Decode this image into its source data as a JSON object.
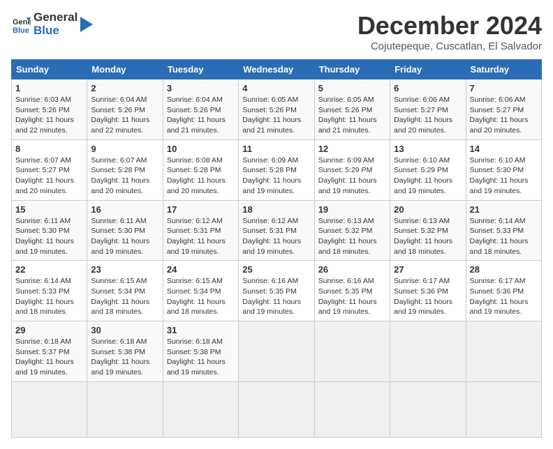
{
  "header": {
    "logo_general": "General",
    "logo_blue": "Blue",
    "title": "December 2024",
    "subtitle": "Cojutepeque, Cuscatlan, El Salvador"
  },
  "calendar": {
    "days_of_week": [
      "Sunday",
      "Monday",
      "Tuesday",
      "Wednesday",
      "Thursday",
      "Friday",
      "Saturday"
    ],
    "weeks": [
      [
        null,
        null,
        null,
        null,
        null,
        null,
        null
      ]
    ],
    "cells": [
      {
        "day": 1,
        "col": 0,
        "sunrise": "6:03 AM",
        "sunset": "5:26 PM",
        "daylight": "11 hours and 22 minutes."
      },
      {
        "day": 2,
        "col": 1,
        "sunrise": "6:04 AM",
        "sunset": "5:26 PM",
        "daylight": "11 hours and 22 minutes."
      },
      {
        "day": 3,
        "col": 2,
        "sunrise": "6:04 AM",
        "sunset": "5:26 PM",
        "daylight": "11 hours and 21 minutes."
      },
      {
        "day": 4,
        "col": 3,
        "sunrise": "6:05 AM",
        "sunset": "5:26 PM",
        "daylight": "11 hours and 21 minutes."
      },
      {
        "day": 5,
        "col": 4,
        "sunrise": "6:05 AM",
        "sunset": "5:26 PM",
        "daylight": "11 hours and 21 minutes."
      },
      {
        "day": 6,
        "col": 5,
        "sunrise": "6:06 AM",
        "sunset": "5:27 PM",
        "daylight": "11 hours and 20 minutes."
      },
      {
        "day": 7,
        "col": 6,
        "sunrise": "6:06 AM",
        "sunset": "5:27 PM",
        "daylight": "11 hours and 20 minutes."
      },
      {
        "day": 8,
        "col": 0,
        "sunrise": "6:07 AM",
        "sunset": "5:27 PM",
        "daylight": "11 hours and 20 minutes."
      },
      {
        "day": 9,
        "col": 1,
        "sunrise": "6:07 AM",
        "sunset": "5:28 PM",
        "daylight": "11 hours and 20 minutes."
      },
      {
        "day": 10,
        "col": 2,
        "sunrise": "6:08 AM",
        "sunset": "5:28 PM",
        "daylight": "11 hours and 20 minutes."
      },
      {
        "day": 11,
        "col": 3,
        "sunrise": "6:09 AM",
        "sunset": "5:28 PM",
        "daylight": "11 hours and 19 minutes."
      },
      {
        "day": 12,
        "col": 4,
        "sunrise": "6:09 AM",
        "sunset": "5:29 PM",
        "daylight": "11 hours and 19 minutes."
      },
      {
        "day": 13,
        "col": 5,
        "sunrise": "6:10 AM",
        "sunset": "5:29 PM",
        "daylight": "11 hours and 19 minutes."
      },
      {
        "day": 14,
        "col": 6,
        "sunrise": "6:10 AM",
        "sunset": "5:30 PM",
        "daylight": "11 hours and 19 minutes."
      },
      {
        "day": 15,
        "col": 0,
        "sunrise": "6:11 AM",
        "sunset": "5:30 PM",
        "daylight": "11 hours and 19 minutes."
      },
      {
        "day": 16,
        "col": 1,
        "sunrise": "6:11 AM",
        "sunset": "5:30 PM",
        "daylight": "11 hours and 19 minutes."
      },
      {
        "day": 17,
        "col": 2,
        "sunrise": "6:12 AM",
        "sunset": "5:31 PM",
        "daylight": "11 hours and 19 minutes."
      },
      {
        "day": 18,
        "col": 3,
        "sunrise": "6:12 AM",
        "sunset": "5:31 PM",
        "daylight": "11 hours and 19 minutes."
      },
      {
        "day": 19,
        "col": 4,
        "sunrise": "6:13 AM",
        "sunset": "5:32 PM",
        "daylight": "11 hours and 18 minutes."
      },
      {
        "day": 20,
        "col": 5,
        "sunrise": "6:13 AM",
        "sunset": "5:32 PM",
        "daylight": "11 hours and 18 minutes."
      },
      {
        "day": 21,
        "col": 6,
        "sunrise": "6:14 AM",
        "sunset": "5:33 PM",
        "daylight": "11 hours and 18 minutes."
      },
      {
        "day": 22,
        "col": 0,
        "sunrise": "6:14 AM",
        "sunset": "5:33 PM",
        "daylight": "11 hours and 18 minutes."
      },
      {
        "day": 23,
        "col": 1,
        "sunrise": "6:15 AM",
        "sunset": "5:34 PM",
        "daylight": "11 hours and 18 minutes."
      },
      {
        "day": 24,
        "col": 2,
        "sunrise": "6:15 AM",
        "sunset": "5:34 PM",
        "daylight": "11 hours and 18 minutes."
      },
      {
        "day": 25,
        "col": 3,
        "sunrise": "6:16 AM",
        "sunset": "5:35 PM",
        "daylight": "11 hours and 19 minutes."
      },
      {
        "day": 26,
        "col": 4,
        "sunrise": "6:16 AM",
        "sunset": "5:35 PM",
        "daylight": "11 hours and 19 minutes."
      },
      {
        "day": 27,
        "col": 5,
        "sunrise": "6:17 AM",
        "sunset": "5:36 PM",
        "daylight": "11 hours and 19 minutes."
      },
      {
        "day": 28,
        "col": 6,
        "sunrise": "6:17 AM",
        "sunset": "5:36 PM",
        "daylight": "11 hours and 19 minutes."
      },
      {
        "day": 29,
        "col": 0,
        "sunrise": "6:18 AM",
        "sunset": "5:37 PM",
        "daylight": "11 hours and 19 minutes."
      },
      {
        "day": 30,
        "col": 1,
        "sunrise": "6:18 AM",
        "sunset": "5:38 PM",
        "daylight": "11 hours and 19 minutes."
      },
      {
        "day": 31,
        "col": 2,
        "sunrise": "6:18 AM",
        "sunset": "5:38 PM",
        "daylight": "11 hours and 19 minutes."
      }
    ]
  }
}
